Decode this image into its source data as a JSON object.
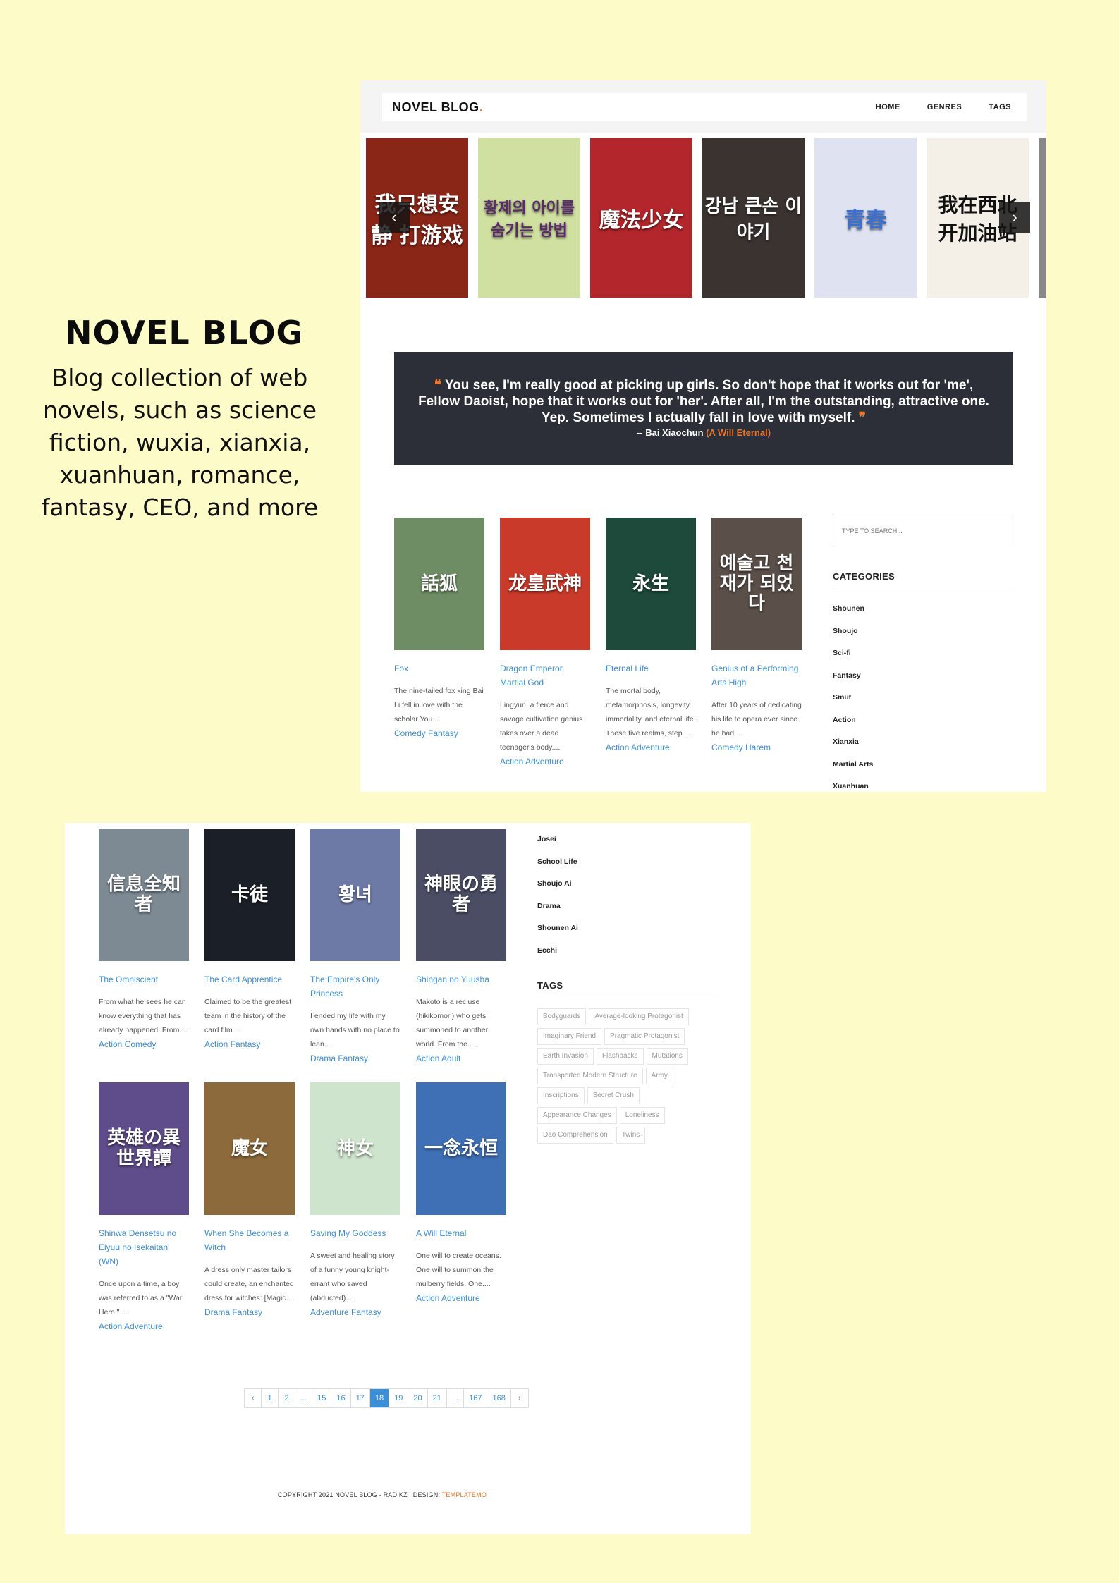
{
  "promo": {
    "title": "NOVEL BLOG",
    "description": "Blog collection of web novels, such as science fiction, wuxia, xianxia, xuanhuan, romance, fantasy, CEO, and more"
  },
  "header": {
    "brand": "NOVEL BLOG",
    "nav": [
      "HOME",
      "GENRES",
      "TAGS"
    ]
  },
  "carousel": {
    "covers": [
      {
        "text": "我只想安静 打游戏",
        "color": "#8a2618"
      },
      {
        "text": "황제의 아이를 숨기는 방법",
        "color": "#cfe0a0"
      },
      {
        "text": "魔法少女",
        "color": "#b3262b"
      },
      {
        "text": "강남 큰손 이야기",
        "color": "#3b3330"
      },
      {
        "text": "青春",
        "color": "#dfe3f1"
      },
      {
        "text": "我在西北 开加油站",
        "color": "#f4efe7"
      }
    ],
    "prev_icon": "chevron-left-icon",
    "next_icon": "chevron-right-icon",
    "prev_glyph": "‹",
    "next_glyph": "›"
  },
  "quote": {
    "text": "You see, I'm really good at picking up girls. So don't hope that it works out for 'me', Fellow Daoist, hope that it works out for 'her'. After all, I'm the outstanding, attractive one. Yep. Sometimes I actually fall in love with myself.",
    "open_mark": "❝",
    "close_mark": "❞",
    "author": "-- Bai Xiaochun",
    "source": "(A Will Eternal)"
  },
  "novels_top": [
    {
      "title": "Fox",
      "desc": "The nine-tailed fox king Bai Li fell in love with the scholar You....",
      "tags": "Comedy Fantasy",
      "cover_text": "話狐",
      "color": "#6e8d64"
    },
    {
      "title": "Dragon Emperor, Martial God",
      "desc": "Lingyun, a fierce and savage cultivation genius takes over a dead teenager's body....",
      "tags": "Action Adventure",
      "cover_text": "龙皇武神",
      "color": "#c93a2a"
    },
    {
      "title": "Eternal Life",
      "desc": "The mortal body, metamorphosis, longevity, immortality, and eternal life. These five realms, step....",
      "tags": "Action Adventure",
      "cover_text": "永生",
      "color": "#1d4a3a"
    },
    {
      "title": "Genius of a Performing Arts High",
      "desc": "After 10 years of dedicating his life to opera ever since he had....",
      "tags": "Comedy Harem",
      "cover_text": "예술고 천재가 되었다",
      "color": "#5b4f49"
    }
  ],
  "search": {
    "placeholder": "TYPE TO SEARCH..."
  },
  "categories": {
    "heading": "CATEGORIES",
    "list_top": [
      "Shounen",
      "Shoujo",
      "Sci-fi",
      "Fantasy",
      "Smut",
      "Action",
      "Xianxia",
      "Martial Arts",
      "Xuanhuan"
    ],
    "list_bottom": [
      "Josei",
      "School Life",
      "Shoujo Ai",
      "Drama",
      "Shounen Ai",
      "Ecchi"
    ]
  },
  "novels_bottom_row1": [
    {
      "title": "The Omniscient",
      "desc": "From what he sees he can know everything that has already happened. From....",
      "tags": "Action Comedy",
      "cover_text": "信息全知者",
      "color": "#7d8a94"
    },
    {
      "title": "The Card Apprentice",
      "desc": "Claimed to be the greatest team in the history of the card film....",
      "tags": "Action Fantasy",
      "cover_text": "卡徒",
      "color": "#1b1f27"
    },
    {
      "title": "The Empire's Only Princess",
      "desc": "I ended my life with my own hands with no place to lean....",
      "tags": "Drama Fantasy",
      "cover_text": "황녀",
      "color": "#6e7aa6"
    },
    {
      "title": "Shingan no Yuusha",
      "desc": "Makoto is a recluse (hikikomori) who gets summoned to another world. From the....",
      "tags": "Action Adult",
      "cover_text": "神眼の勇者",
      "color": "#4a4d63"
    }
  ],
  "novels_bottom_row2": [
    {
      "title": "Shinwa Densetsu no Eiyuu no Isekaitan (WN)",
      "desc": "Once upon a time, a boy was referred to as a \"War Hero.\" ....",
      "tags": "Action Adventure",
      "cover_text": "英雄の異世界譚",
      "color": "#5f4c8a"
    },
    {
      "title": "When She Becomes a Witch",
      "desc": "A dress only master tailors could create, an enchanted dress for witches: [Magic....",
      "tags": "Drama Fantasy",
      "cover_text": "魔女",
      "color": "#8d6a3c"
    },
    {
      "title": "Saving My Goddess",
      "desc": "A sweet and healing story of a funny young knight-errant who saved (abducted)....",
      "tags": "Adventure Fantasy",
      "cover_text": "神女",
      "color": "#cfe4cc"
    },
    {
      "title": "A Will Eternal",
      "desc": "One will to create oceans. One will to summon the mulberry fields. One....",
      "tags": "Action Adventure",
      "cover_text": "一念永恒",
      "color": "#3f6fb4"
    }
  ],
  "tags": {
    "heading": "TAGS",
    "items": [
      "Bodyguards",
      "Average-looking Protagonist",
      "Imaginary Friend",
      "Pragmatic Protagonist",
      "Earth Invasion",
      "Flashbacks",
      "Mutations",
      "Transported Modern Structure",
      "Army",
      "Inscriptions",
      "Secret Crush",
      "Appearance Changes",
      "Loneliness",
      "Dao Comprehension",
      "Twins"
    ]
  },
  "pagination": {
    "pages": [
      "‹",
      "1",
      "2",
      "...",
      "15",
      "16",
      "17",
      "18",
      "19",
      "20",
      "21",
      "...",
      "167",
      "168",
      "›"
    ],
    "current": "18"
  },
  "footer": {
    "text": "COPYRIGHT 2021 NOVEL BLOG - RADIKZ | DESIGN: ",
    "link": "TEMPLATEMO"
  }
}
